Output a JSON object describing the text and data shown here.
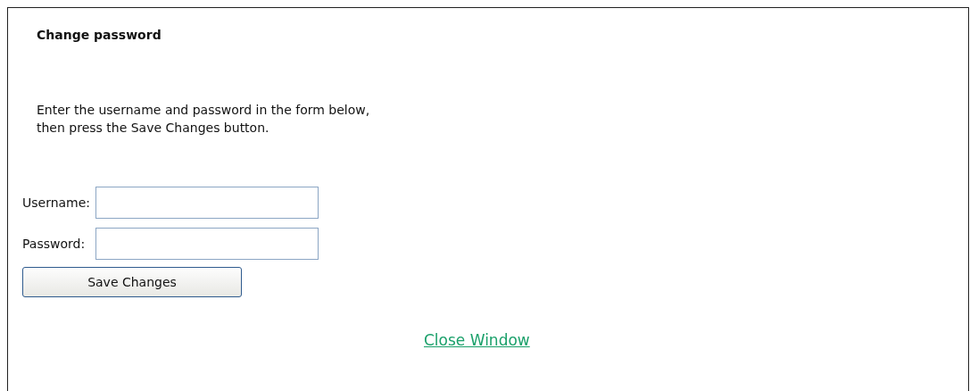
{
  "title": "Change password",
  "instructions": "Enter the username and password in the form below,\nthen press the Save Changes button.",
  "fields": [
    {
      "label": "Username:"
    },
    {
      "label": "Password:"
    }
  ],
  "save_button": "Save Changes",
  "close_link": "Close Window"
}
